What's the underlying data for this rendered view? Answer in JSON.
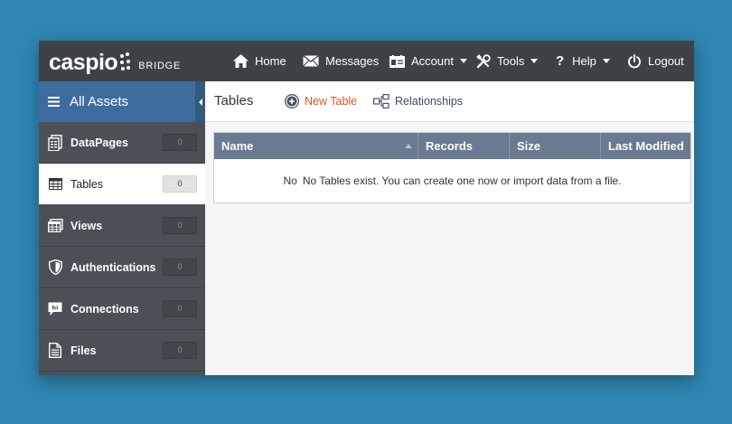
{
  "app": {
    "logo_text": "caspio",
    "logo_sub": "BRIDGE"
  },
  "nav": {
    "home": "Home",
    "messages": "Messages",
    "account": "Account",
    "tools": "Tools",
    "help": "Help",
    "logout": "Logout"
  },
  "sidebar": {
    "header": "All Assets",
    "items": [
      {
        "label": "DataPages",
        "count": "0",
        "icon": "datapages-icon"
      },
      {
        "label": "Tables",
        "count": "0",
        "icon": "table-icon"
      },
      {
        "label": "Views",
        "count": "0",
        "icon": "views-icon"
      },
      {
        "label": "Authentications",
        "count": "0",
        "icon": "shield-icon"
      },
      {
        "label": "Connections",
        "count": "0",
        "icon": "connections-icon"
      },
      {
        "label": "Files",
        "count": "0",
        "icon": "file-icon"
      }
    ]
  },
  "toolbar": {
    "title": "Tables",
    "new_table": "New Table",
    "relationships": "Relationships"
  },
  "grid": {
    "columns": [
      "Name",
      "Records",
      "Size",
      "Last Modified"
    ],
    "empty_lead": "No",
    "empty_part1": "No Tables exist. You can",
    "create_link": "create one now",
    "empty_part2": "or",
    "import_link": "import data from a file",
    "empty_end": "."
  },
  "colors": {
    "background": "#2e86b3",
    "topbar": "#3e4246",
    "sidebar": "#4b5056",
    "assets_header": "#3f6c9f",
    "grid_header": "#6a7b91",
    "new_table_accent": "#d9531e",
    "relationships_text": "#3a4a63"
  }
}
